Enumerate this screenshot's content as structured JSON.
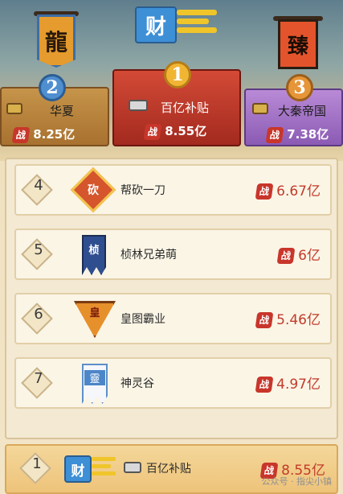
{
  "podium": {
    "first": {
      "flag_char": "财",
      "rank": "1",
      "name": "百亿补贴",
      "power": "8.55亿"
    },
    "second": {
      "flag_char": "龍",
      "rank": "2",
      "name": "华夏",
      "power": "8.25亿"
    },
    "third": {
      "flag_char": "臻",
      "rank": "3",
      "name": "大秦帝国",
      "power": "7.38亿"
    }
  },
  "power_tag": "战",
  "list": [
    {
      "rank": "4",
      "emblem": "砍",
      "name": "帮砍一刀",
      "power": "6.67亿"
    },
    {
      "rank": "5",
      "emblem": "桢",
      "name": "桢林兄弟萌",
      "power": "6亿"
    },
    {
      "rank": "6",
      "emblem": "皇",
      "name": "皇图霸业",
      "power": "5.46亿"
    },
    {
      "rank": "7",
      "emblem": "靈",
      "name": "神灵谷",
      "power": "4.97亿"
    }
  ],
  "self": {
    "rank": "1",
    "emblem": "财",
    "name": "百亿补贴",
    "power": "8.55亿"
  },
  "watermark": "公众号 · 指尖小镇",
  "colors": {
    "accent_red": "#c23b2b",
    "gold": "#e7b34a",
    "purple": "#9b6fc0",
    "blue": "#3d7fb8"
  }
}
